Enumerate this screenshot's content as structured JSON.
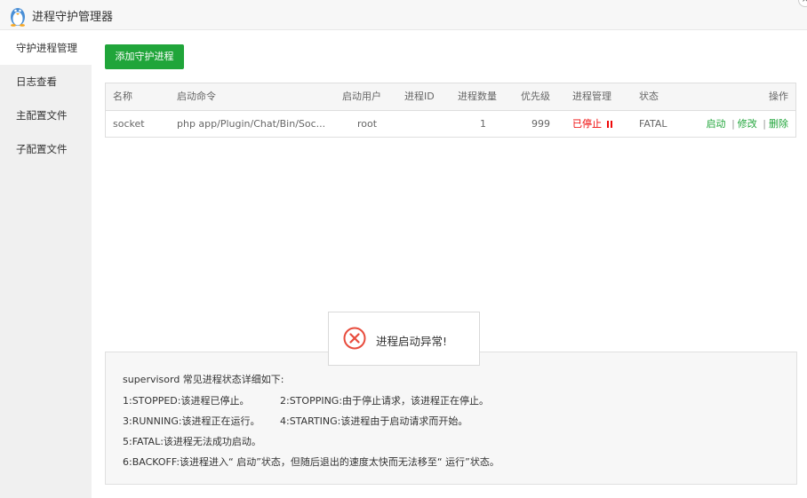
{
  "window": {
    "title": "进程守护管理器",
    "close_symbol": "×"
  },
  "sidebar": {
    "items": [
      {
        "label": "守护进程管理",
        "active": true
      },
      {
        "label": "日志查看",
        "active": false
      },
      {
        "label": "主配置文件",
        "active": false
      },
      {
        "label": "子配置文件",
        "active": false
      }
    ]
  },
  "toolbar": {
    "add_label": "添加守护进程"
  },
  "table": {
    "headers": {
      "name": "名称",
      "command": "启动命令",
      "user": "启动用户",
      "pid": "进程ID",
      "count": "进程数量",
      "priority": "优先级",
      "manage": "进程管理",
      "status": "状态",
      "ops": "操作"
    },
    "rows": [
      {
        "name": "socket",
        "command": "php app/Plugin/Chat/Bin/Soc...",
        "user": "root",
        "pid": "",
        "count": "1",
        "priority": "999",
        "manage": "已停止",
        "status": "FATAL",
        "op_start": "启动",
        "op_edit": "修改",
        "op_delete": "删除",
        "op_sep": "|"
      }
    ]
  },
  "toast": {
    "message": "进程启动异常!"
  },
  "help": {
    "title": "supervisord 常见进程状态详细如下:",
    "line1a": "1:STOPPED:该进程已停止。",
    "line1b": "2:STOPPING:由于停止请求，该进程正在停止。",
    "line2a": "3:RUNNING:该进程正在运行。",
    "line2b": "4:STARTING:该进程由于启动请求而开始。",
    "line3": "5:FATAL:该进程无法成功启动。",
    "line4": "6:BACKOFF:该进程进入“ 启动”状态，但随后退出的速度太快而无法移至“ 运行”状态。"
  },
  "colors": {
    "accent": "#20a53a",
    "stopped": "#ef0808",
    "error_icon": "#e84c3d"
  }
}
